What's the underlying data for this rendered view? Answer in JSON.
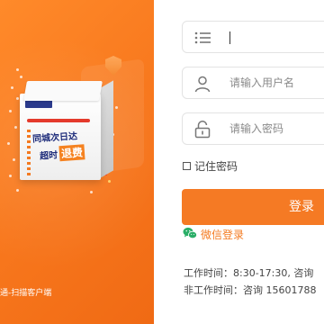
{
  "branding": {
    "box_logo": "",
    "box_slogan_line1": "同城次日达",
    "box_slogan_line2": "超时",
    "box_slogan_highlight": "退费",
    "tagline": "通-扫描客户端"
  },
  "form": {
    "account_type_value": "",
    "username_placeholder": "请输入用户名",
    "password_placeholder": "请输入密码",
    "remember_label": "记住密码",
    "remember_checked": false,
    "login_label": "登录",
    "wechat_login_label": "微信登录",
    "work_hours": "工作时间：8:30-17:30, 咨询",
    "off_hours": "非工作时间：咨询 15601788"
  },
  "colors": {
    "brand_orange": "#f57a24",
    "wechat_green": "#2aae67",
    "box_navy": "#1d2b7a"
  },
  "icons": {
    "list": "list-icon",
    "user": "user-icon",
    "lock": "lock-icon",
    "wechat": "wechat-icon"
  }
}
